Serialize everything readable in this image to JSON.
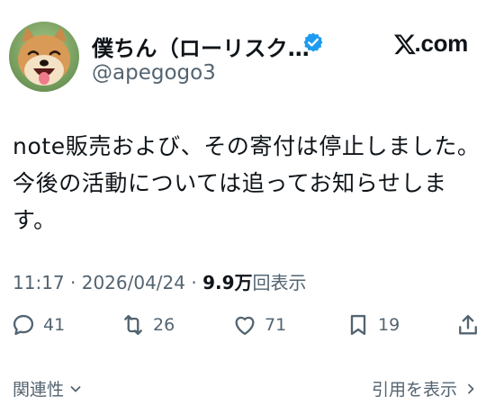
{
  "author": {
    "display_name": "僕ちん（ローリスク…",
    "handle": "@apegogo3",
    "verified": true,
    "avatar_icon": "smiling-dog-avatar"
  },
  "brand": {
    "logo_icon": "x-logo-icon",
    "domain": ".com"
  },
  "tweet": {
    "text": "note販売および、その寄付は停止しました。今後の活動については追ってお知らせします。"
  },
  "meta": {
    "time": "11:17",
    "separator": " · ",
    "date": "2026/04/24",
    "views_count": "9.9万",
    "views_label": "回表示"
  },
  "actions": {
    "replies": "41",
    "retweets": "26",
    "likes": "71",
    "bookmarks": "19",
    "share_icon": "share-icon"
  },
  "footer": {
    "related_label": "関連性",
    "quotes_label": "引用を表示"
  },
  "colors": {
    "text_primary": "#0f1419",
    "text_secondary": "#536471",
    "verified_blue": "#1d9bf0"
  }
}
